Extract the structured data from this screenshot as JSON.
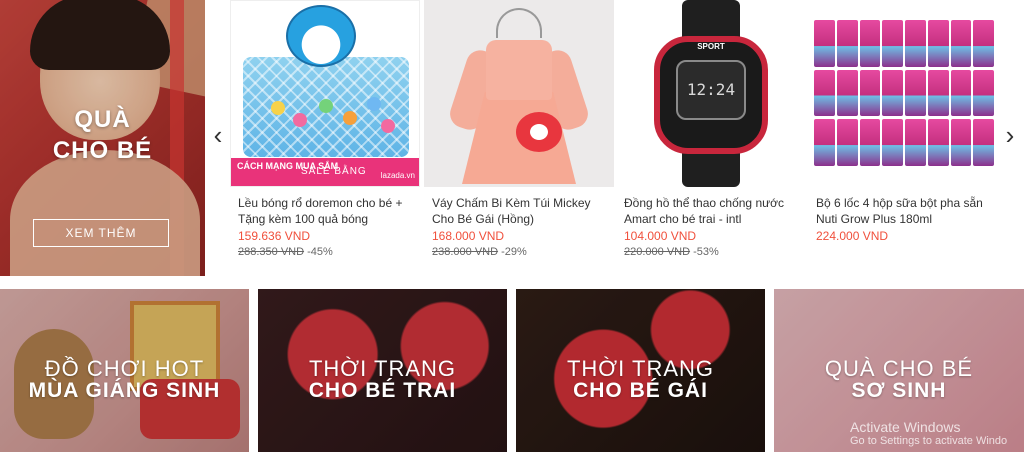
{
  "hero": {
    "title_line1": "QUÀ",
    "title_line2": "CHO BÉ",
    "button_label": "XEM THÊM"
  },
  "carousel": {
    "prev_glyph": "‹",
    "next_glyph": "›",
    "products": [
      {
        "name": "Lều bóng rổ doremon cho bé + Tặng kèm 100 quả bóng",
        "price": "159.636 VND",
        "old_price": "288.350 VND",
        "discount": "-45%",
        "image_banner": "CÁCH MẠNG MUA SẮM",
        "image_sale": "SALE BẰNG",
        "image_brand": "lazada.vn"
      },
      {
        "name": "Váy Chấm Bi Kèm Túi Mickey Cho Bé Gái (Hồng)",
        "price": "168.000 VND",
        "old_price": "238.000 VND",
        "discount": "-29%"
      },
      {
        "name": "Đồng hồ thể thao chống nước Amart cho bé trai - intl",
        "price": "104.000 VND",
        "old_price": "220.000 VND",
        "discount": "-53%",
        "image_face": "12:24",
        "image_label": "SPORT"
      },
      {
        "name": "Bộ 6 lốc 4 hộp sữa bột pha sẵn Nuti Grow Plus 180ml",
        "price": "224.000 VND"
      }
    ]
  },
  "categories": [
    {
      "line1": "ĐỒ CHƠI HOT",
      "line2": "MÙA GIÁNG SINH"
    },
    {
      "line1": "THỜI TRANG",
      "line2": "CHO BÉ TRAI"
    },
    {
      "line1": "THỜI TRANG",
      "line2": "CHO BÉ GÁI"
    },
    {
      "line1": "QUÀ CHO BÉ",
      "line2": "SƠ SINH"
    }
  ],
  "os_watermark": {
    "title": "Activate Windows",
    "subtitle": "Go to Settings to activate Windo"
  },
  "colors": {
    "price": "#f0503c",
    "accent_red": "#c8263c"
  }
}
